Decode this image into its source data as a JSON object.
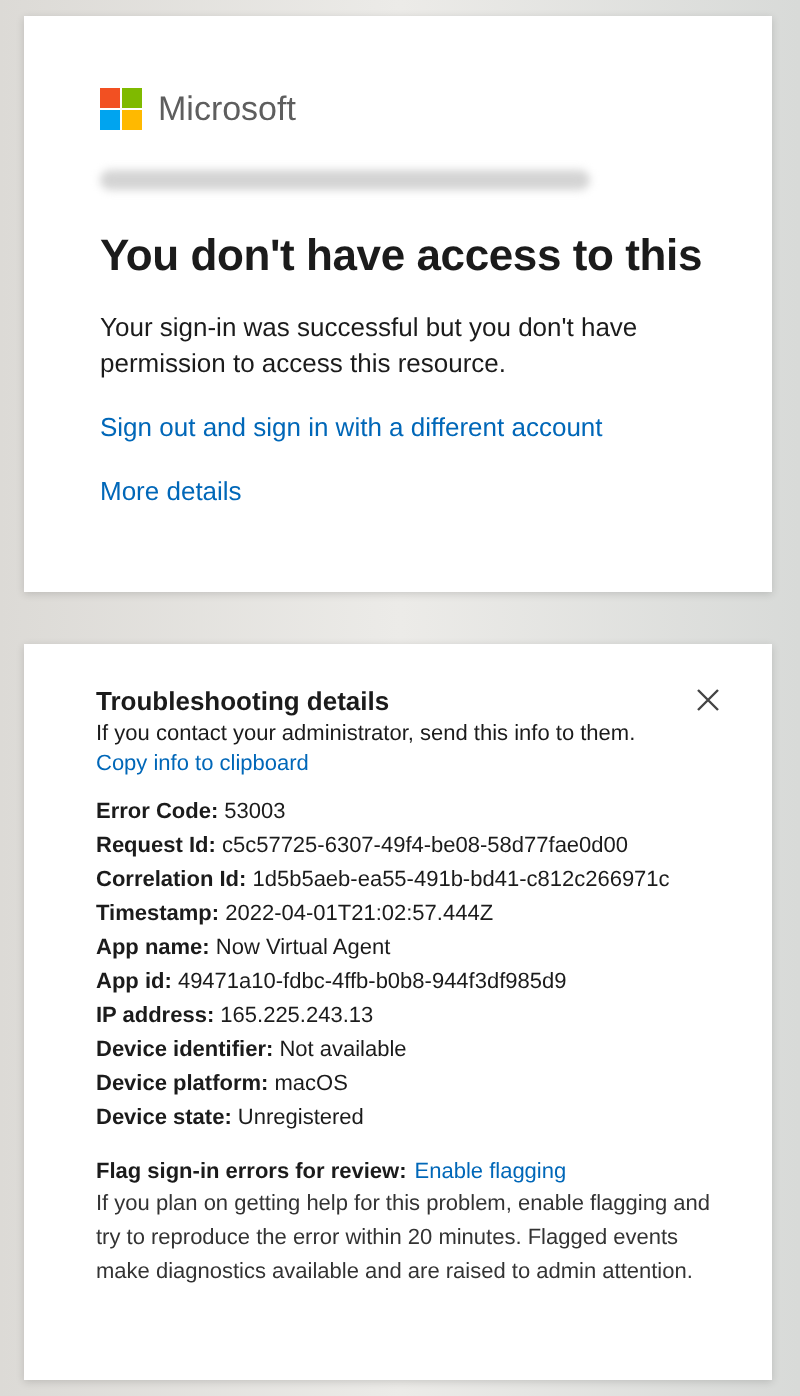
{
  "brand": {
    "name": "Microsoft"
  },
  "heading": "You don't have access to this",
  "message": "Your sign-in was successful but you don't have permission to access this resource.",
  "links": [
    "Sign out and sign in with a different account",
    "More details"
  ],
  "troubleshooting": {
    "title": "Troubleshooting details",
    "intro": "If you contact your administrator, send this info to them.",
    "copy_link": "Copy info to clipboard",
    "details": [
      {
        "label": "Error Code:",
        "value": "53003"
      },
      {
        "label": "Request Id:",
        "value": "c5c57725-6307-49f4-be08-58d77fae0d00"
      },
      {
        "label": "Correlation Id:",
        "value": "1d5b5aeb-ea55-491b-bd41-c812c266971c"
      },
      {
        "label": "Timestamp:",
        "value": "2022-04-01T21:02:57.444Z"
      },
      {
        "label": "App name:",
        "value": "Now Virtual Agent"
      },
      {
        "label": "App id:",
        "value": "49471a10-fdbc-4ffb-b0b8-944f3df985d9"
      },
      {
        "label": "IP address:",
        "value": "165.225.243.13"
      },
      {
        "label": "Device identifier:",
        "value": "Not available"
      },
      {
        "label": "Device platform:",
        "value": "macOS"
      },
      {
        "label": "Device state:",
        "value": "Unregistered"
      }
    ],
    "flag_label": "Flag sign-in errors for review:",
    "flag_link": "Enable flagging",
    "flag_text": "If you plan on getting help for this problem, enable flagging and try to reproduce the error within 20 minutes. Flagged events make diagnostics available and are raised to admin attention."
  }
}
